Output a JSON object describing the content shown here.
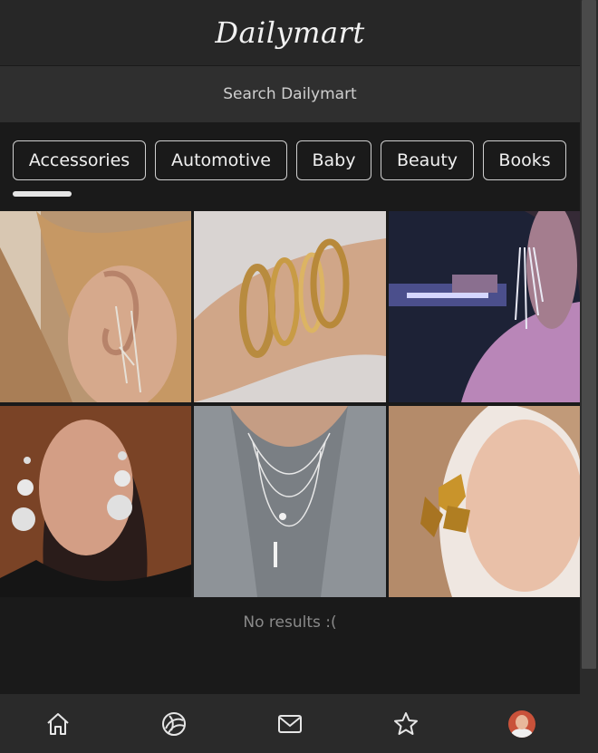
{
  "app": {
    "title": "Dailymart"
  },
  "search": {
    "placeholder": "Search Dailymart"
  },
  "categories": [
    "Accessories",
    "Automotive",
    "Baby",
    "Beauty",
    "Books"
  ],
  "products": [
    {
      "name": "ear-cuff-chain-earring"
    },
    {
      "name": "gold-chain-bracelets"
    },
    {
      "name": "crystal-tassel-earring"
    },
    {
      "name": "sequin-ball-drop-earring"
    },
    {
      "name": "layered-pendant-necklace"
    },
    {
      "name": "gold-butterfly-earring"
    }
  ],
  "status": {
    "empty_message": "No results :("
  },
  "nav": {
    "items": [
      {
        "icon": "home-icon"
      },
      {
        "icon": "explore-icon"
      },
      {
        "icon": "mail-icon"
      },
      {
        "icon": "star-icon"
      },
      {
        "icon": "profile-avatar"
      }
    ]
  },
  "colors": {
    "background": "#1a1a1a",
    "header": "#272727",
    "search": "#2f2f2f",
    "nav": "#2a2a2a"
  }
}
